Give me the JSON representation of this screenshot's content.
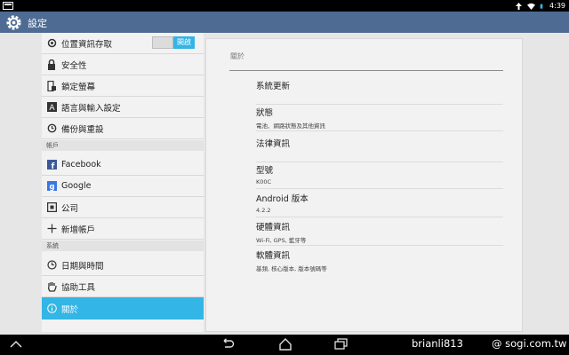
{
  "status_bar": {
    "time": "4:39"
  },
  "action_bar": {
    "title": "設定"
  },
  "left_panel": {
    "location": {
      "label": "位置資訊存取",
      "toggle_on_label": "開啟"
    },
    "items_personal": [
      {
        "label": "安全性",
        "icon": "lock-icon"
      },
      {
        "label": "鎖定螢幕",
        "icon": "phone-lock-icon"
      },
      {
        "label": "語言與輸入設定",
        "icon": "keyboard-a-icon"
      },
      {
        "label": "備份與重設",
        "icon": "backup-icon"
      }
    ],
    "section_accounts": "帳戶",
    "items_accounts": [
      {
        "label": "Facebook",
        "icon": "facebook-icon"
      },
      {
        "label": "Google",
        "icon": "google-icon"
      },
      {
        "label": "公司",
        "icon": "company-icon"
      },
      {
        "label": "新增帳戶",
        "icon": "plus-icon"
      }
    ],
    "section_system": "系統",
    "items_system": [
      {
        "label": "日期與時間",
        "icon": "clock-icon"
      },
      {
        "label": "協助工具",
        "icon": "hand-icon"
      },
      {
        "label": "關於",
        "icon": "info-icon",
        "selected": true
      }
    ]
  },
  "right_panel": {
    "header": "關於",
    "items": [
      {
        "title": "系統更新",
        "subtitle": ""
      },
      {
        "title": "狀態",
        "subtitle": "電池、網路狀態及其他資訊"
      },
      {
        "title": "法律資訊",
        "subtitle": ""
      },
      {
        "title": "型號",
        "subtitle": "K00C"
      },
      {
        "title": "Android 版本",
        "subtitle": "4.2.2"
      },
      {
        "title": "硬體資訊",
        "subtitle": "Wi-Fi, GPS, 藍牙等"
      },
      {
        "title": "軟體資訊",
        "subtitle": "基頻, 核心版本, 版本號碼等"
      }
    ]
  },
  "watermark": {
    "user": "brianli813",
    "site": "@ sogi.com.tw"
  },
  "colors": {
    "action_bar": "#4e6c93",
    "accent": "#33b5e5",
    "panel": "#f2f2f2"
  }
}
